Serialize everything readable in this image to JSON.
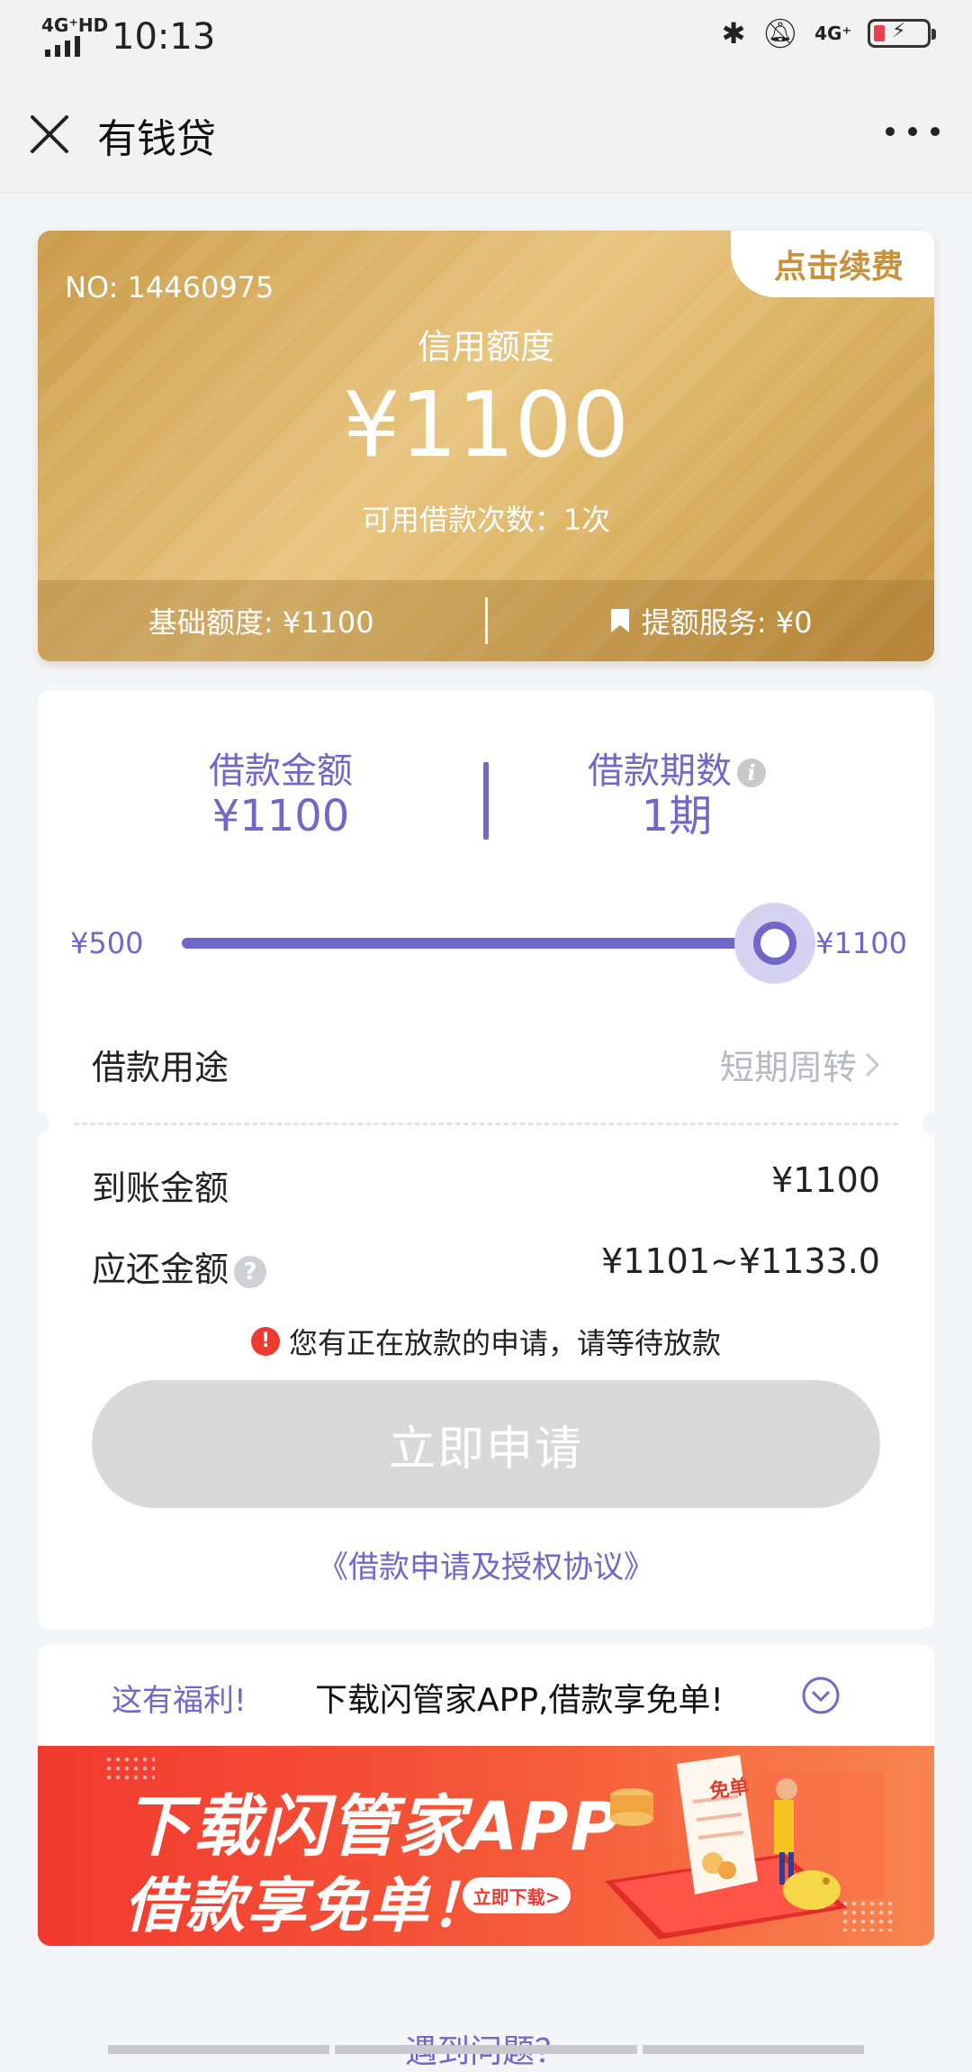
{
  "status_bar": {
    "network": "4G⁺HD",
    "time": "10:13",
    "network_right": "4G⁺"
  },
  "nav": {
    "title": "有钱贷",
    "close_icon": "close-icon",
    "more_icon": "more-dots-icon"
  },
  "credit_card": {
    "renew_label": "点击续费",
    "number": "NO: 14460975",
    "label": "信用额度",
    "amount": "¥1100",
    "available_count": "可用借款次数：1次",
    "base_limit": "基础额度: ¥1100",
    "boost_service": "提额服务: ¥0",
    "accent": "#c9913a"
  },
  "loan": {
    "amount_label": "借款金额",
    "amount_value": "¥1100",
    "term_label": "借款期数",
    "term_value": "1期",
    "slider_min": "¥500",
    "slider_max": "¥1100",
    "slider_fraction": 1.0,
    "purpose_label": "借款用途",
    "purpose_value": "短期周转",
    "arrive_label": "到账金额",
    "arrive_value": "¥1100",
    "repay_label": "应还金额",
    "repay_value": "¥1101~¥1133.0",
    "warning": "您有正在放款的申请，请等待放款",
    "apply_button": "立即申请",
    "agreement": "《借款申请及授权协议》",
    "accent": "#7267c9"
  },
  "promo": {
    "tag": "这有福利!",
    "text": "下载闪管家APP,借款享免单!",
    "banner_line1": "下载闪管家APP",
    "banner_line2": "借款享免单！",
    "banner_button": "立即下载>",
    "banner_receipt": "免单"
  },
  "help": {
    "label": "遇到问题？"
  }
}
